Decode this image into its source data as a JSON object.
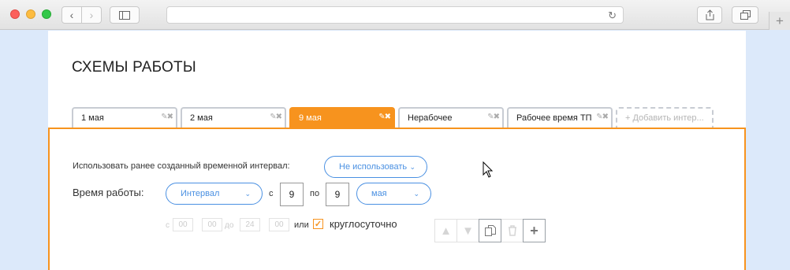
{
  "browser": {
    "back_icon": "chevron-left-icon",
    "forward_icon": "chevron-right-icon",
    "sidebar_icon": "sidebar-icon",
    "reload_icon": "reload-icon",
    "share_icon": "share-icon",
    "tabs_icon": "tabs-icon",
    "newtab_icon": "plus-icon"
  },
  "page": {
    "title": "СХЕМЫ РАБОТЫ"
  },
  "tabs": [
    {
      "label": "1 мая",
      "active": false
    },
    {
      "label": "2 мая",
      "active": false
    },
    {
      "label": "9 мая",
      "active": true
    },
    {
      "label": "Нерабочее",
      "active": false
    },
    {
      "label": "Рабочее время ТП",
      "active": false
    }
  ],
  "add_tab": {
    "label": "+ Добавить интер..."
  },
  "form": {
    "reuse_label": "Использовать ранее созданный временной интервал:",
    "reuse_value": "Не использовать",
    "worktime_label": "Время работы:",
    "interval_value": "Интервал",
    "from_label": "с",
    "from_value": "9",
    "to_label": "по",
    "to_value": "9",
    "month_value": "мая",
    "time_from_label": "с",
    "time_h1": "00",
    "time_m1": "00",
    "time_to_label": "до",
    "time_h2": "24",
    "time_m2": "00",
    "or_label": "или",
    "allday_checked": true,
    "allday_label": "круглосуточно"
  },
  "toolbar": {
    "icons": [
      "arrow-up-icon",
      "arrow-down-icon",
      "copy-icon",
      "trash-icon",
      "plus-icon"
    ]
  },
  "colors": {
    "accent": "#f7931e",
    "link": "#4a90e2"
  }
}
